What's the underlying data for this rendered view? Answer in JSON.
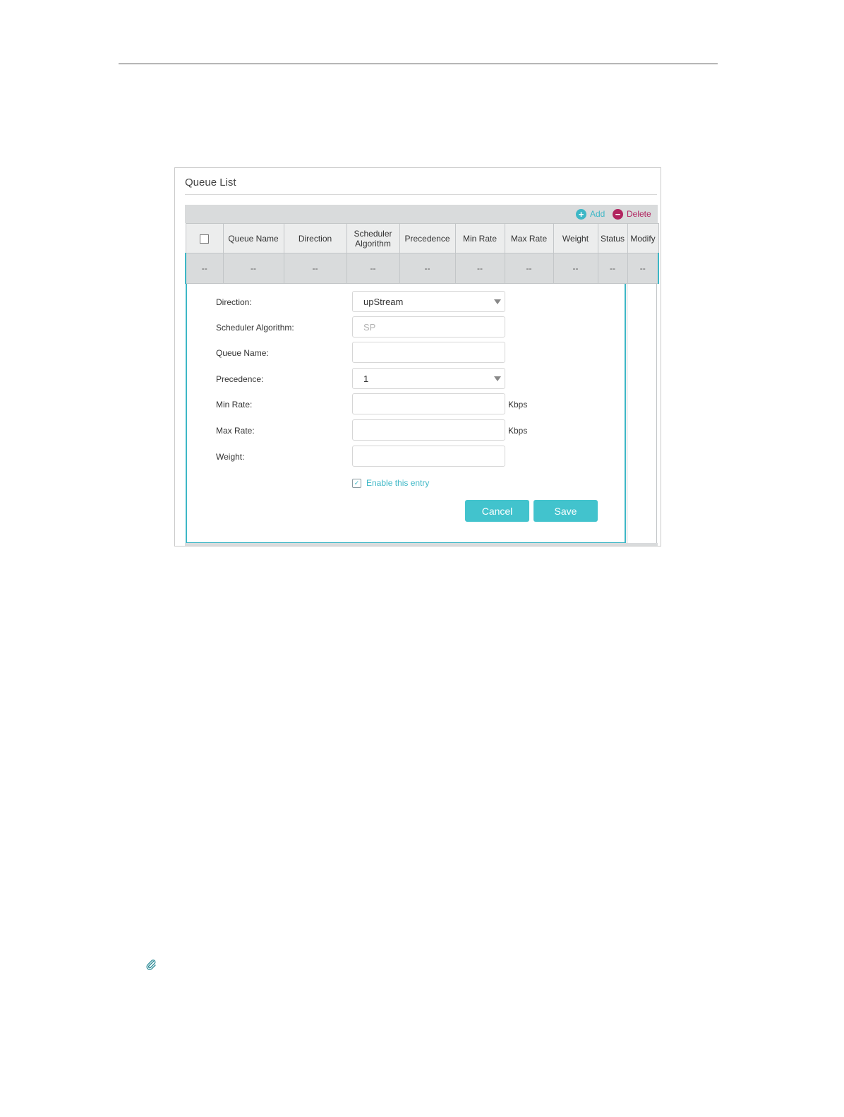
{
  "panel": {
    "title": "Queue List"
  },
  "toolbar": {
    "add_label": "Add",
    "delete_label": "Delete",
    "add_icon": "plus-circle-icon",
    "delete_icon": "minus-circle-icon"
  },
  "table": {
    "columns": [
      "",
      "Queue Name",
      "Direction",
      "Scheduler Algorithm",
      "Precedence",
      "Min Rate",
      "Max Rate",
      "Weight",
      "Status",
      "Modify"
    ],
    "row": [
      "--",
      "--",
      "--",
      "--",
      "--",
      "--",
      "--",
      "--",
      "--",
      "--"
    ]
  },
  "form": {
    "direction_label": "Direction:",
    "direction_value": "upStream",
    "scheduler_label": "Scheduler Algorithm:",
    "scheduler_value": "SP",
    "queue_name_label": "Queue Name:",
    "queue_name_value": "",
    "precedence_label": "Precedence:",
    "precedence_value": "1",
    "min_rate_label": "Min Rate:",
    "min_rate_value": "",
    "max_rate_label": "Max Rate:",
    "max_rate_value": "",
    "weight_label": "Weight:",
    "weight_value": "",
    "unit": "Kbps",
    "enable_label": "Enable this entry",
    "enable_checked": true,
    "cancel_label": "Cancel",
    "save_label": "Save"
  },
  "colors": {
    "accent": "#42c3cd",
    "delete": "#b1245f"
  },
  "footer": {
    "icon": "paperclip-icon"
  }
}
